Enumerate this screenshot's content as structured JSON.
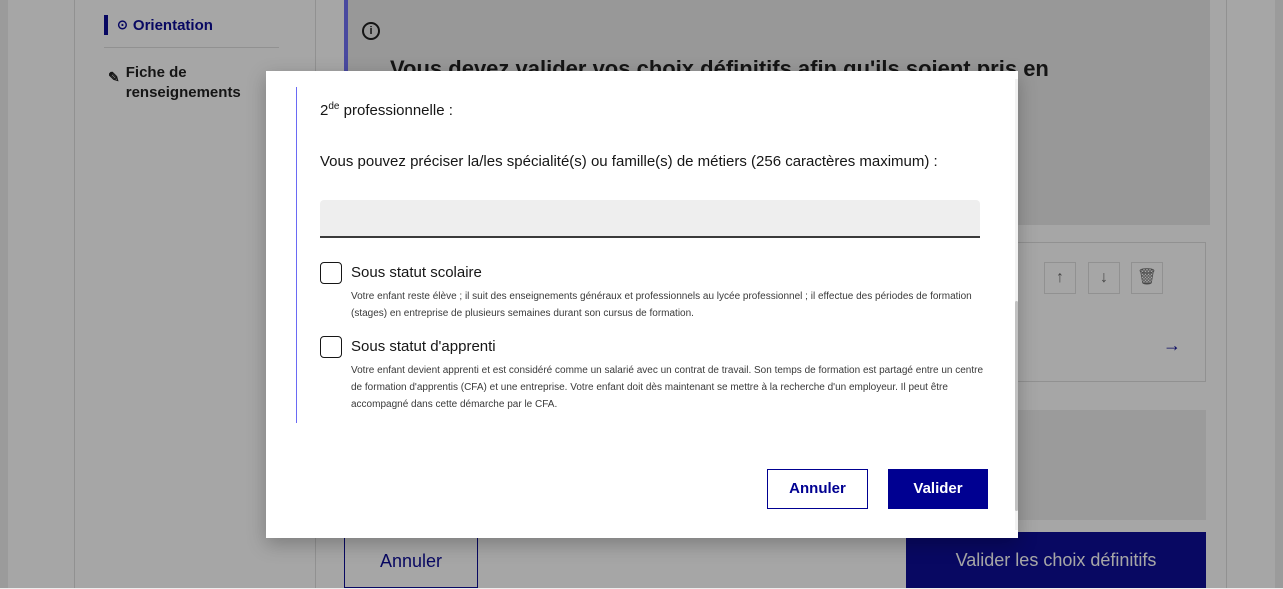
{
  "background": {
    "sidebar": {
      "active_item": "Orientation",
      "item2": "Fiche de renseignements"
    },
    "alert": {
      "icon_text": "i",
      "text": "Vous devez valider vos choix définitifs afin qu'ils soient pris en"
    },
    "card": {
      "up_icon": "↑",
      "down_icon": "↓",
      "trash_icon": "🗑",
      "arrow_icon": "→"
    },
    "footer": {
      "cancel_label": "Annuler",
      "validate_label": "Valider les choix définitifs"
    }
  },
  "modal": {
    "heading_prefix": "2",
    "heading_sup": "de",
    "heading_suffix": " professionnelle :",
    "specialty_label": "Vous pouvez préciser la/les spécialité(s) ou famille(s) de métiers (256 caractères maximum) :",
    "specialty_value": "",
    "options": [
      {
        "title": "Sous statut scolaire",
        "description": "Votre enfant reste élève ; il suit des enseignements généraux et professionnels au lycée professionnel ; il effectue des périodes de formation (stages) en entreprise de plusieurs semaines durant son cursus de formation.",
        "checked": false
      },
      {
        "title": "Sous statut d'apprenti",
        "description": "Votre enfant devient apprenti et est considéré comme un salarié avec un contrat de travail. Son temps de formation est partagé entre un centre de formation d'apprentis (CFA) et une entreprise. Votre enfant doit dès maintenant se mettre à la recherche d'un employeur. Il peut être accompagné dans cette démarche par le CFA.",
        "checked": false
      }
    ],
    "cancel_label": "Annuler",
    "validate_label": "Valider"
  },
  "colors": {
    "primary": "#000091",
    "accent_border": "#6a6af4"
  }
}
